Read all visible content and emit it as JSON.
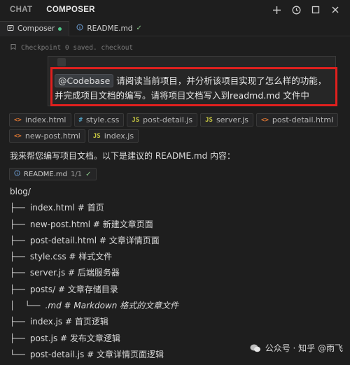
{
  "topbar": {
    "tabs": [
      {
        "label": "CHAT",
        "active": false
      },
      {
        "label": "COMPOSER",
        "active": true
      }
    ],
    "icons": [
      "plus-icon",
      "history-icon",
      "maximize-icon",
      "close-icon"
    ]
  },
  "file_tabs": [
    {
      "label": "Composer",
      "dirty": true,
      "active": true
    },
    {
      "label": "README.md",
      "saved": true,
      "active": false
    }
  ],
  "checkpoint": {
    "text": "Checkpoint 0 saved. checkout"
  },
  "prompt": {
    "mention": "@Codebase",
    "text": " 请阅读当前项目，并分析该项目实现了怎么样的功能，并完成项目文档的编写。请将项目文档写入到readmd.md 文件中"
  },
  "context_files": [
    [
      {
        "name": "index.html",
        "type": "html"
      },
      {
        "name": "style.css",
        "type": "css"
      },
      {
        "name": "post-detail.js",
        "type": "js"
      },
      {
        "name": "server.js",
        "type": "js"
      },
      {
        "name": "post-detail.html",
        "type": "html"
      }
    ],
    [
      {
        "name": "new-post.html",
        "type": "html"
      },
      {
        "name": "index.js",
        "type": "js"
      }
    ]
  ],
  "reply": {
    "text": "我来帮您编写项目文档。以下是建议的 README.md 内容："
  },
  "readme_chip": {
    "label": "README.md",
    "count": "1/1"
  },
  "tree": [
    {
      "branch": "",
      "name": "blog/",
      "comment": ""
    },
    {
      "branch": "├── ",
      "name": "index.html",
      "comment": " # 首页"
    },
    {
      "branch": "├── ",
      "name": "new-post.html",
      "comment": " # 新建文章页面"
    },
    {
      "branch": "├── ",
      "name": "post-detail.html",
      "comment": " # 文章详情页面"
    },
    {
      "branch": "├── ",
      "name": "style.css",
      "comment": " # 样式文件"
    },
    {
      "branch": "├── ",
      "name": "server.js",
      "comment": " # 后端服务器"
    },
    {
      "branch": "├── ",
      "name": "posts/",
      "comment": " # 文章存储目录"
    },
    {
      "branch": "│  └── ",
      "name": ".md",
      "comment": " # Markdown 格式的文章文件",
      "italic": true
    },
    {
      "branch": "├── ",
      "name": "index.js",
      "comment": " # 首页逻辑"
    },
    {
      "branch": "├── ",
      "name": "post.js",
      "comment": " # 发布文章逻辑"
    },
    {
      "branch": "└── ",
      "name": "post-detail.js",
      "comment": " # 文章详情页面逻辑"
    }
  ],
  "watermark": {
    "text": "公众号 · 知乎 @雨飞"
  },
  "colors": {
    "highlight": "#e0201e",
    "background": "#1e1e1e"
  }
}
